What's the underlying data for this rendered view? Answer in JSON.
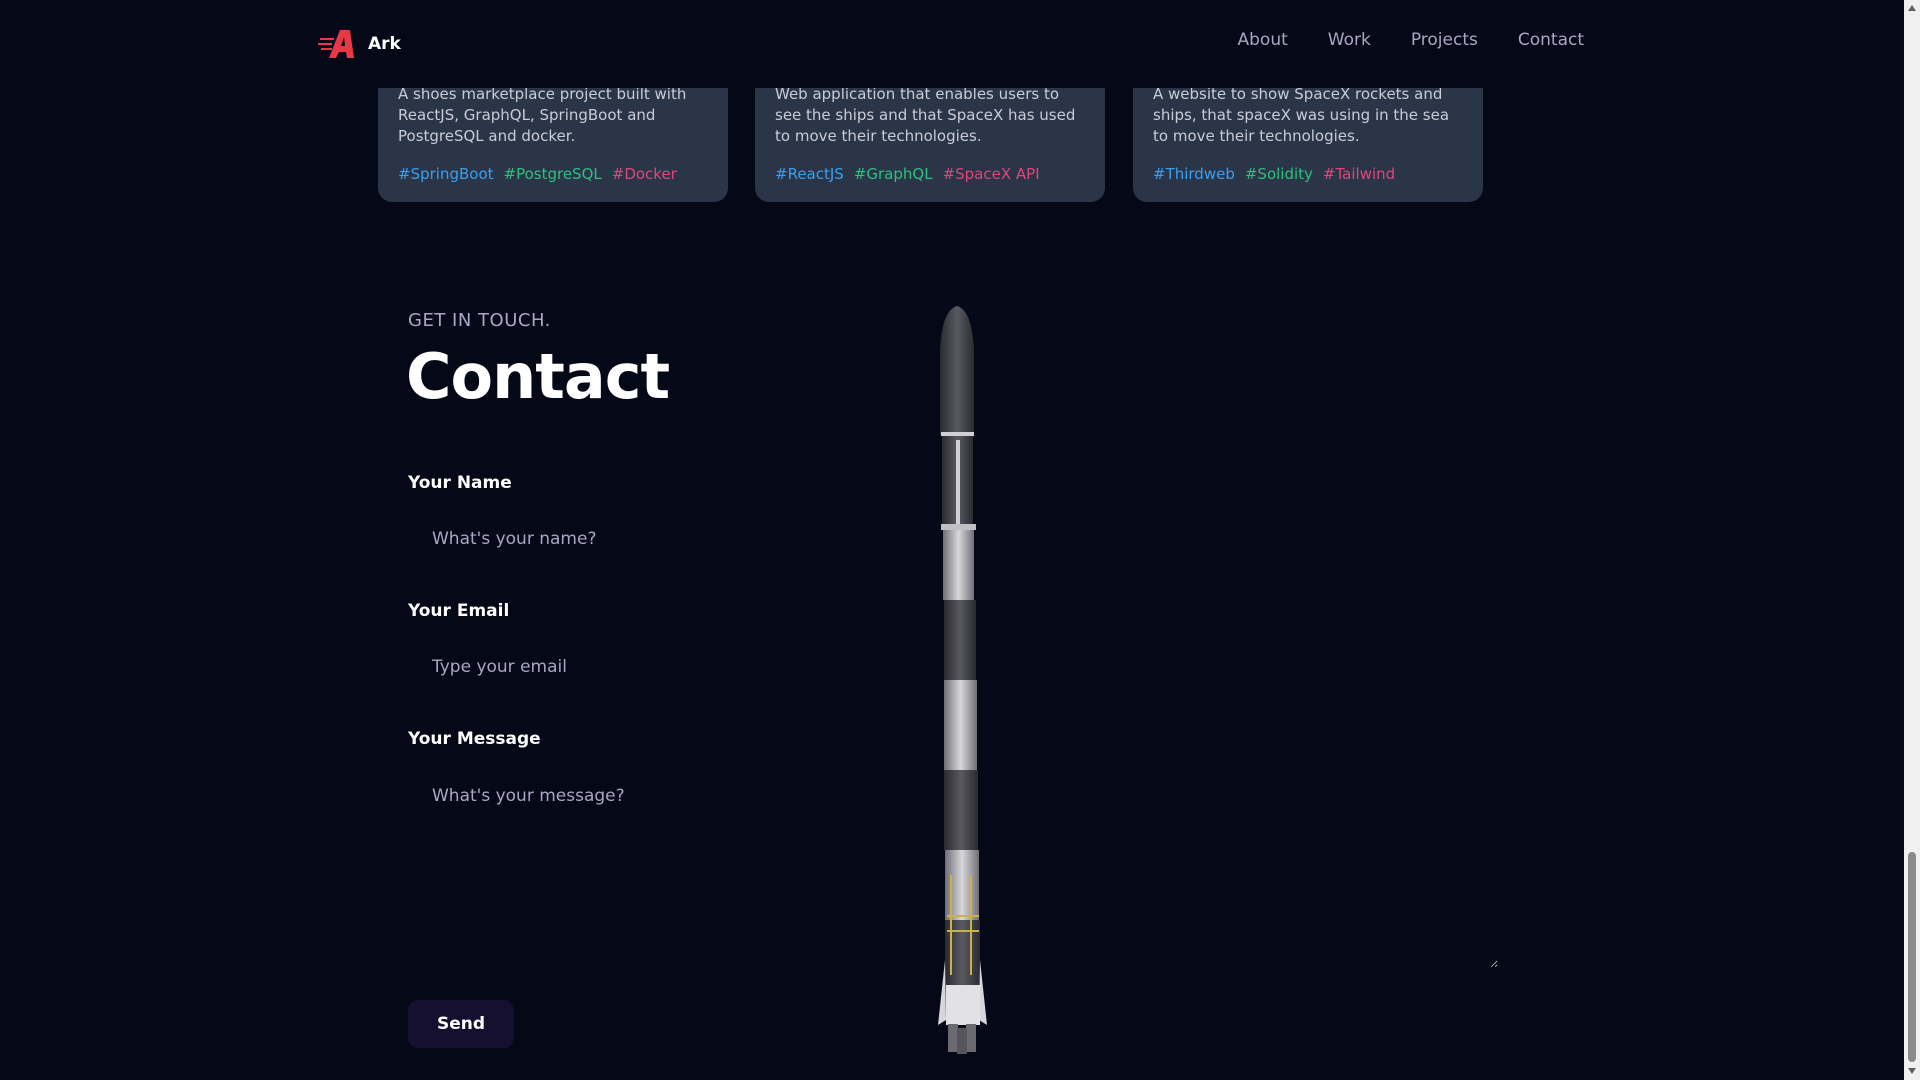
{
  "navbar": {
    "brand": "Ark",
    "links": [
      "About",
      "Work",
      "Projects",
      "Contact"
    ]
  },
  "projects": [
    {
      "description": "A shoes marketplace project built with ReactJS, GraphQL, SpringBoot and PostgreSQL and docker.",
      "tags": [
        "#SpringBoot",
        "#PostgreSQL",
        "#Docker"
      ]
    },
    {
      "description": "Web application that enables users to see the ships and that SpaceX has used to move their technologies.",
      "tags": [
        "#ReactJS",
        "#GraphQL",
        "#SpaceX API"
      ]
    },
    {
      "description": "A website to show SpaceX rockets and ships, that spaceX was using in the sea to move their technologies.",
      "tags": [
        "#Thirdweb",
        "#Solidity",
        "#Tailwind"
      ]
    }
  ],
  "contact": {
    "subtitle": "GET IN TOUCH.",
    "title": "Contact",
    "name_label": "Your Name",
    "name_placeholder": "What's your name?",
    "email_label": "Your Email",
    "email_placeholder": "Type your email",
    "message_label": "Your Message",
    "message_placeholder": "What's your message?",
    "send_label": "Send"
  },
  "colors": {
    "background": "#050816",
    "card": "#2b3548",
    "tag_blue": "#3b9ff0",
    "tag_green": "#2fbf7f",
    "tag_pink": "#e0457b",
    "logo_red": "#e63946",
    "button_bg": "#151030"
  },
  "icons": [
    "ark-logo-icon",
    "rocket-model",
    "scroll-up-icon",
    "scroll-down-icon"
  ]
}
